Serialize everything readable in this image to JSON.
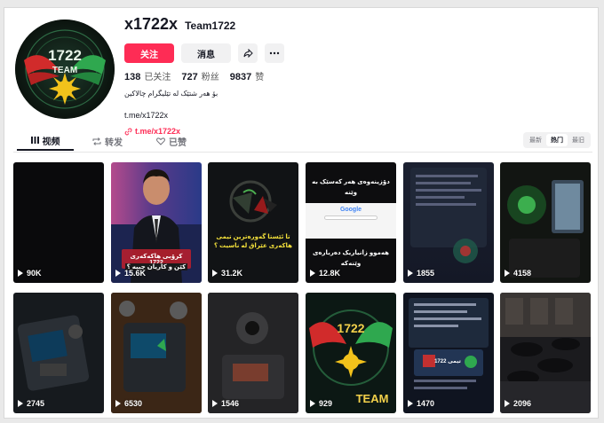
{
  "profile": {
    "handle": "x1722x",
    "nickname": "Team1722",
    "avatar_text": "1722",
    "avatar_subtext": "TEAM",
    "follow_label": "关注",
    "message_label": "消息",
    "share_icon": "share-icon",
    "more_icon": "more-icon",
    "stats": {
      "following_count": "138",
      "following_label": "已关注",
      "followers_count": "727",
      "followers_label": "粉丝",
      "likes_count": "9837",
      "likes_label": "赞"
    },
    "bio": "بۆ هەر شتێک لە تێلیگرام چالاکین",
    "link_text": "t.me/x1722x",
    "link_url": "t.me/x1722x"
  },
  "tabs": [
    {
      "label": "视频",
      "icon": "grid-icon"
    },
    {
      "label": "转发",
      "icon": "repost-icon"
    },
    {
      "label": "已赞",
      "icon": "heart-icon"
    }
  ],
  "sort": [
    "最新",
    "热门",
    "最旧"
  ],
  "videos": [
    {
      "views": "90K"
    },
    {
      "views": "15.6K",
      "caption1": "کرۆبی هاکەکەری 1722",
      "caption2": "کێن و کاریان چییە ؟"
    },
    {
      "views": "31.2K",
      "caption1": "تا ئێستا گەورەترین تیمی",
      "caption2": "هاکەری عێراق لە ناسیت ؟"
    },
    {
      "views": "12.8K",
      "caption1": "دۆزینەوەی هەر کەسێک بە",
      "caption2": "وێنە",
      "caption3": "هەموو زانیاریک دەربارەی",
      "caption4": "وێنەکە",
      "google": "Google"
    },
    {
      "views": "1855"
    },
    {
      "views": "4158"
    },
    {
      "views": "2745"
    },
    {
      "views": "6530"
    },
    {
      "views": "1546"
    },
    {
      "views": "929",
      "caption1": "1722",
      "caption2": "TEAM"
    },
    {
      "views": "1470",
      "caption1": "تیمی 1722"
    },
    {
      "views": "2096"
    }
  ]
}
